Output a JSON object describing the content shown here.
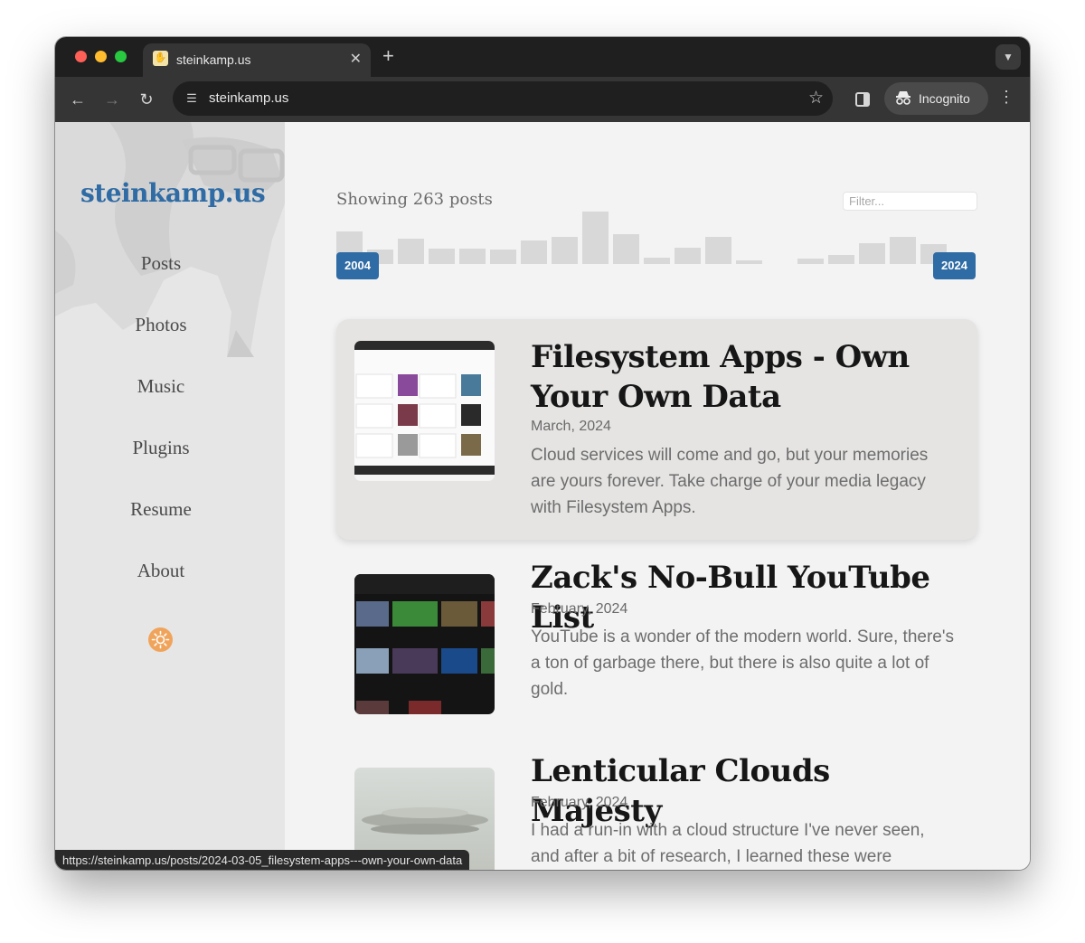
{
  "browser": {
    "tab": {
      "title": "steinkamp.us",
      "favicon": "waving-hand-icon"
    },
    "url": "steinkamp.us",
    "incognito_label": "Incognito",
    "status_url": "https://steinkamp.us/posts/2024-03-05_filesystem-apps---own-your-own-data"
  },
  "sidebar": {
    "brand": "steinkamp.us",
    "nav": [
      {
        "label": "Posts"
      },
      {
        "label": "Photos"
      },
      {
        "label": "Music"
      },
      {
        "label": "Plugins"
      },
      {
        "label": "Resume"
      },
      {
        "label": "About"
      }
    ]
  },
  "main": {
    "showing": "Showing 263 posts",
    "filter_placeholder": "Filter...",
    "year_start": "2004",
    "year_end": "2024",
    "histogram": [
      0.62,
      0.28,
      0.48,
      0.3,
      0.3,
      0.28,
      0.45,
      0.52,
      1.0,
      0.57,
      0.12,
      0.31,
      0.52,
      0.07,
      0,
      0.11,
      0.18,
      0.4,
      0.52,
      0.38
    ],
    "posts": [
      {
        "title": "Filesystem Apps - Own Your Own Data",
        "date": "March, 2024",
        "summary": "Cloud services will come and go, but your memories are yours forever. Take charge of your media legacy with Filesystem Apps."
      },
      {
        "title": "Zack's No-Bull YouTube List",
        "date": "February, 2024",
        "summary": "YouTube is a wonder of the modern world. Sure, there's a ton of garbage there, but there is also quite a lot of gold."
      },
      {
        "title": "Lenticular Clouds Majesty",
        "date": "February, 2024",
        "summary": "I had a run-in with a cloud structure I've never seen, and after a bit of research, I learned these were lenticular clouds."
      }
    ]
  },
  "colors": {
    "brand": "#2f6ba4",
    "accent": "#f0a45b"
  }
}
